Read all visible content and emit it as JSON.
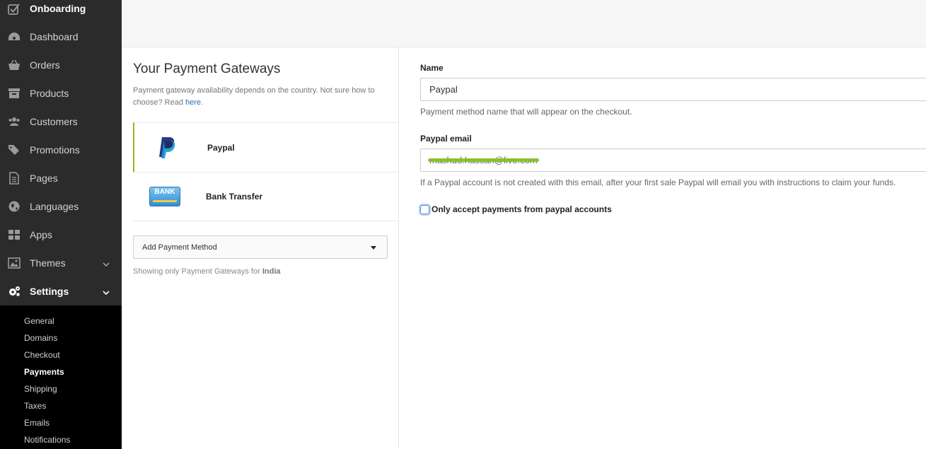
{
  "sidebar": {
    "items": [
      {
        "label": "Onboarding",
        "icon": "checkbox-icon"
      },
      {
        "label": "Dashboard",
        "icon": "gauge-icon"
      },
      {
        "label": "Orders",
        "icon": "basket-icon"
      },
      {
        "label": "Products",
        "icon": "archive-box-icon"
      },
      {
        "label": "Customers",
        "icon": "users-icon"
      },
      {
        "label": "Promotions",
        "icon": "tags-icon"
      },
      {
        "label": "Pages",
        "icon": "page-icon"
      },
      {
        "label": "Languages",
        "icon": "globe-icon"
      },
      {
        "label": "Apps",
        "icon": "grid-icon"
      },
      {
        "label": "Themes",
        "icon": "image-icon"
      },
      {
        "label": "Settings",
        "icon": "gears-icon"
      }
    ],
    "settings_sub": [
      "General",
      "Domains",
      "Checkout",
      "Payments",
      "Shipping",
      "Taxes",
      "Emails",
      "Notifications"
    ]
  },
  "gateways": {
    "title": "Your Payment Gateways",
    "desc_text": "Payment gateway availability depends on the country. Not sure how to choose? Read",
    "desc_link": "here",
    "desc_end": ".",
    "list": [
      {
        "label": "Paypal",
        "icon": "paypal-logo"
      },
      {
        "label": "Bank Transfer",
        "icon": "bank-logo",
        "logo_text": "BANK"
      }
    ],
    "add_method": "Add Payment Method",
    "showing_prefix": "Showing only Payment Gateways for",
    "country": "India"
  },
  "form": {
    "name_label": "Name",
    "name_value": "Paypal",
    "name_help": "Payment method name that will appear on the checkout.",
    "email_label": "Paypal email",
    "email_value": "mashud.hassan@live.com",
    "email_help": "If a Paypal account is not created with this email, after your first sale Paypal will email you with instructions to claim your funds.",
    "checkbox_label": "Only accept payments from paypal accounts",
    "checkbox_checked": false
  },
  "colors": {
    "sidebar_bg": "#2b2b2b",
    "subnav_bg": "#000000",
    "selected_accent": "#9bb51f",
    "link": "#2a6ebb"
  }
}
